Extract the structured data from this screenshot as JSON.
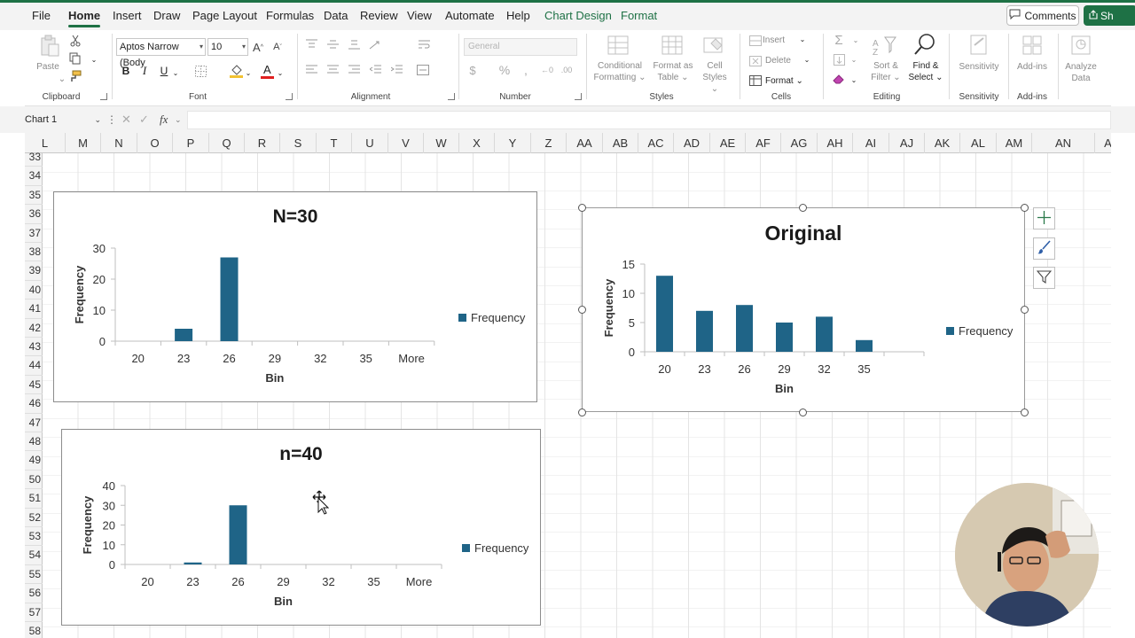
{
  "menu": {
    "tabs": [
      "File",
      "Home",
      "Insert",
      "Draw",
      "Page Layout",
      "Formulas",
      "Data",
      "Review",
      "View",
      "Automate",
      "Help"
    ],
    "active_tab": "Home",
    "context_tabs": [
      "Chart Design",
      "Format"
    ],
    "comments_label": "Comments",
    "share_label": "Sh"
  },
  "ribbon": {
    "clipboard": {
      "paste_label": "Paste",
      "group_label": "Clipboard"
    },
    "font": {
      "font_name": "Aptos Narrow (Body",
      "font_size": "10",
      "group_label": "Font"
    },
    "alignment": {
      "group_label": "Alignment"
    },
    "number": {
      "format": "General",
      "group_label": "Number"
    },
    "styles": {
      "conditional_formatting": [
        "Conditional",
        "Formatting"
      ],
      "format_as_table": [
        "Format as",
        "Table"
      ],
      "cell_styles": [
        "Cell",
        "Styles"
      ],
      "group_label": "Styles"
    },
    "cells": {
      "insert": "Insert",
      "delete": "Delete",
      "format": "Format",
      "group_label": "Cells"
    },
    "editing": {
      "sort_filter": [
        "Sort &",
        "Filter"
      ],
      "find_select": [
        "Find &",
        "Select"
      ],
      "group_label": "Editing"
    },
    "sensitivity": {
      "label": "Sensitivity",
      "group_label": "Sensitivity"
    },
    "addins": {
      "label": "Add-ins",
      "group_label": "Add-ins"
    },
    "analyze": {
      "label": [
        "Analyze",
        "Data"
      ]
    }
  },
  "formula_bar": {
    "name_box": "Chart 1",
    "fx": "fx",
    "content": ""
  },
  "grid": {
    "columns": [
      "L",
      "M",
      "N",
      "O",
      "P",
      "Q",
      "R",
      "S",
      "T",
      "U",
      "V",
      "W",
      "X",
      "Y",
      "Z",
      "AA",
      "AB",
      "AC",
      "AD",
      "AE",
      "AF",
      "AG",
      "AH",
      "AI",
      "AJ",
      "AK",
      "AL",
      "AM",
      "AN",
      "A"
    ],
    "rows": [
      "33",
      "34",
      "35",
      "36",
      "37",
      "38",
      "39",
      "40",
      "41",
      "42",
      "43",
      "44",
      "45",
      "46",
      "47",
      "48",
      "49",
      "50",
      "51",
      "52",
      "53",
      "54",
      "55",
      "56",
      "57",
      "58"
    ]
  },
  "colors": {
    "bar": "#1f6487",
    "accent": "#1e7145",
    "ribbon_bg": "#f3f3f3"
  },
  "chart_data": [
    {
      "type": "bar",
      "title": "N=30",
      "categories": [
        "20",
        "23",
        "26",
        "29",
        "32",
        "35",
        "More"
      ],
      "series": [
        {
          "name": "Frequency",
          "values": [
            0,
            4,
            27,
            0,
            0,
            0,
            0
          ]
        }
      ],
      "xlabel": "Bin",
      "ylabel": "Frequency",
      "ylim": [
        0,
        30
      ],
      "yticks": [
        "0",
        "10",
        "20",
        "30"
      ],
      "legend": "right",
      "grid": false
    },
    {
      "type": "bar",
      "title": "n=40",
      "categories": [
        "20",
        "23",
        "26",
        "29",
        "32",
        "35",
        "More"
      ],
      "series": [
        {
          "name": "Frequency",
          "values": [
            0,
            1,
            30,
            0,
            0,
            0,
            0
          ]
        }
      ],
      "xlabel": "Bin",
      "ylabel": "Frequency",
      "ylim": [
        0,
        40
      ],
      "yticks": [
        "0",
        "10",
        "20",
        "30",
        "40"
      ],
      "legend": "right",
      "grid": false
    },
    {
      "type": "bar",
      "title": "Original",
      "categories": [
        "20",
        "23",
        "26",
        "29",
        "32",
        "35"
      ],
      "series": [
        {
          "name": "Frequency",
          "values": [
            13,
            7,
            8,
            5,
            6,
            2
          ]
        }
      ],
      "xlabel": "Bin",
      "ylabel": "Frequency",
      "ylim": [
        0,
        15
      ],
      "yticks": [
        "0",
        "5",
        "10",
        "15"
      ],
      "legend": "right",
      "grid": false
    }
  ]
}
